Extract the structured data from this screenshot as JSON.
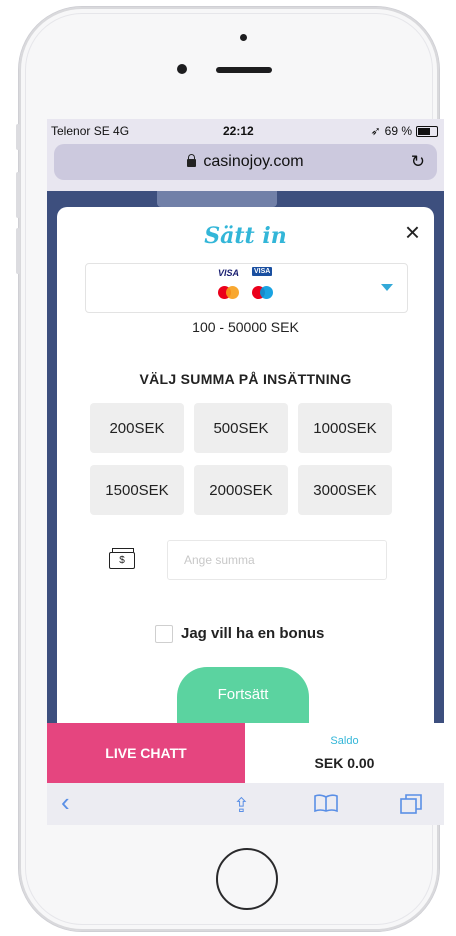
{
  "status_bar": {
    "carrier": "Telenor SE  4G",
    "time": "22:12",
    "battery": "69 %"
  },
  "browser": {
    "url": "casinojoy.com"
  },
  "modal": {
    "title": "Sätt in",
    "close_symbol": "×",
    "payment_methods": [
      "VISA",
      "VISA",
      "mastercard",
      "maestro"
    ],
    "range": "100 - 50000 SEK",
    "section_title": "VÄLJ SUMMA PÅ INSÄTTNING",
    "amounts": [
      "200SEK",
      "500SEK",
      "1000SEK",
      "1500SEK",
      "2000SEK",
      "3000SEK"
    ],
    "amount_placeholder": "Ange summa",
    "money_icon_text": "$",
    "bonus_label": "Jag vill ha en bonus",
    "bonus_checked": false,
    "continue_label": "Fortsätt"
  },
  "footer": {
    "live_chat": "LIVE CHATT",
    "balance_label": "Saldo",
    "balance_value": "SEK 0.00"
  },
  "toolbar": {
    "back": "‹",
    "share": "⇪",
    "bookmarks": "📖",
    "tabs": "❐"
  },
  "colors": {
    "accent": "#33b6d8",
    "live_chat": "#e5457f",
    "continue": "#5bd3a0"
  }
}
